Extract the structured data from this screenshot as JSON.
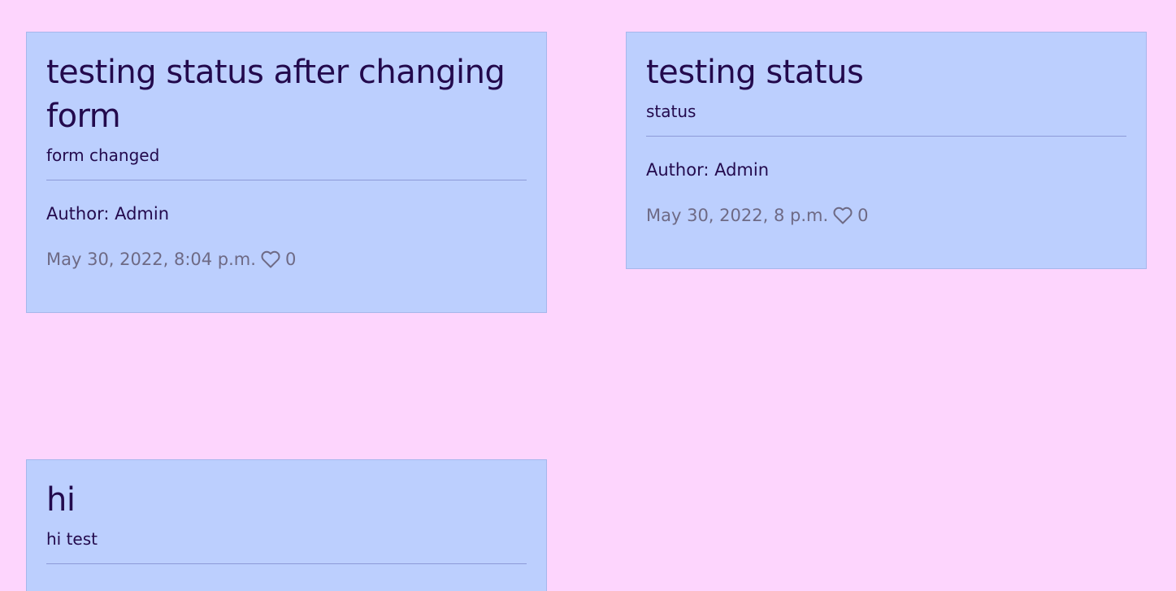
{
  "posts": [
    {
      "title": "testing status after changing form",
      "excerpt": "form changed",
      "author": "Author: Admin",
      "date": "May 30, 2022, 8:04 p.m.",
      "likes": "0",
      "like_icon": "heart-outline-icon"
    },
    {
      "title": "testing status",
      "excerpt": "status",
      "author": "Author: Admin",
      "date": "May 30, 2022, 8 p.m.",
      "likes": "0",
      "like_icon": "heart-outline-icon"
    },
    {
      "title": "hi",
      "excerpt": "hi test"
    }
  ],
  "colors": {
    "background": "#fdd5fd",
    "card": "#bccffe",
    "text": "#230a4d",
    "muted": "#6e6a85"
  }
}
